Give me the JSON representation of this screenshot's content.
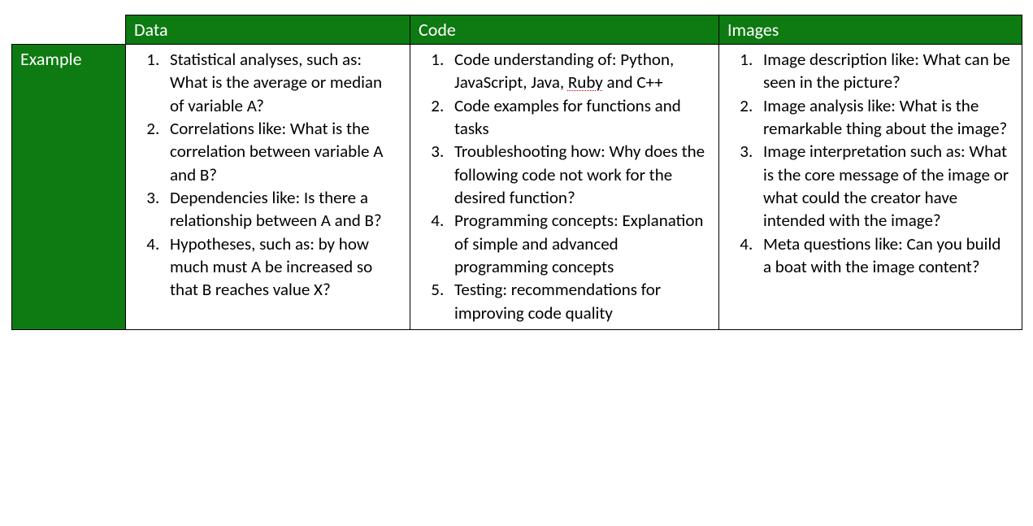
{
  "colors": {
    "header_green": "#0e7a12",
    "text": "#000000",
    "bg": "#ffffff"
  },
  "headers": {
    "row_label": "Example",
    "col1": "Data",
    "col2": "Code",
    "col3": "Images"
  },
  "cells": {
    "data": [
      "Statistical analyses, such as: What is the average or median of variable A?",
      "Correlations like: What is the correlation between variable A and B?",
      "Dependencies like: Is there a relationship between A and B?",
      "Hypotheses, such as: by how much must A be increased so that B reaches value X?"
    ],
    "code": [
      "Code understanding of: Python, JavaScript, Java, Ruby and C++",
      "Code examples for functions and tasks",
      "Troubleshooting how: Why does the following code not work for the desired function?",
      "Programming concepts: Explanation of simple and advanced programming concepts",
      "Testing: recommendations for improving code quality"
    ],
    "images": [
      "Image description like: What can be seen in the picture?",
      "Image analysis like: What is the remarkable thing about the image?",
      "Image interpretation such as: What is the core message of the image or what could the creator have intended with the image?",
      "Meta questions like: Can you build a boat with the image content?"
    ]
  }
}
